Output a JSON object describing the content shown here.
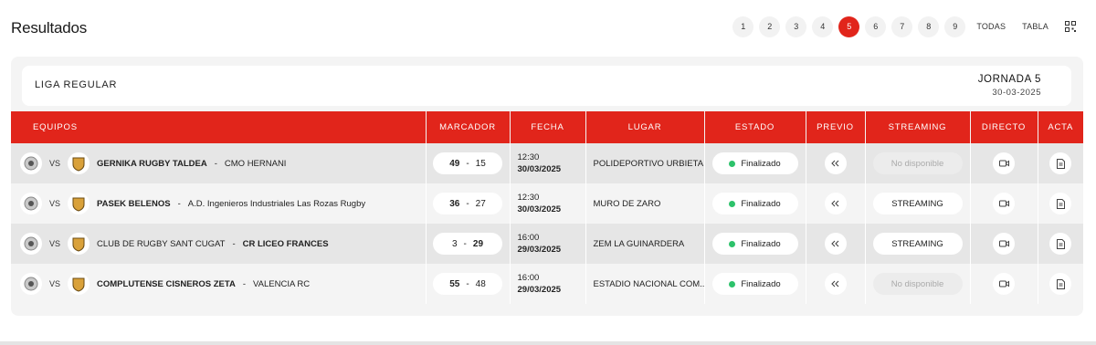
{
  "header": {
    "title": "Resultados",
    "pages": [
      "1",
      "2",
      "3",
      "4",
      "5",
      "6",
      "7",
      "8",
      "9"
    ],
    "active_page": "5",
    "all_label": "TODAS",
    "table_label": "TABLA"
  },
  "league": {
    "name": "LIGA REGULAR",
    "jornada": "JORNADA 5",
    "date": "30-03-2025"
  },
  "columns": {
    "equipos": "EQUIPOS",
    "marcador": "MARCADOR",
    "fecha": "FECHA",
    "lugar": "LUGAR",
    "estado": "ESTADO",
    "previo": "PREVIO",
    "streaming": "STREAMING",
    "directo": "DIRECTO",
    "acta": "ACTA"
  },
  "matches": [
    {
      "vs": "VS",
      "home": "GERNIKA RUGBY TALDEA",
      "away": "CMO HERNANI",
      "winner": "home",
      "home_score": "49",
      "away_score": "15",
      "dash": "-",
      "time": "12:30",
      "date": "30/03/2025",
      "venue": "POLIDEPORTIVO URBIETA",
      "status": "Finalizado",
      "streaming": "No disponible",
      "streaming_available": false
    },
    {
      "vs": "VS",
      "home": "PASEK BELENOS",
      "away": "A.D. Ingenieros Industriales Las Rozas Rugby",
      "winner": "home",
      "home_score": "36",
      "away_score": "27",
      "dash": "-",
      "time": "12:30",
      "date": "30/03/2025",
      "venue": "MURO DE ZARO",
      "status": "Finalizado",
      "streaming": "STREAMING",
      "streaming_available": true
    },
    {
      "vs": "VS",
      "home": "CLUB DE RUGBY SANT CUGAT",
      "away": "CR LICEO FRANCES",
      "winner": "away",
      "home_score": "3",
      "away_score": "29",
      "dash": "-",
      "time": "16:00",
      "date": "29/03/2025",
      "venue": "ZEM LA GUINARDERA",
      "status": "Finalizado",
      "streaming": "STREAMING",
      "streaming_available": true
    },
    {
      "vs": "VS",
      "home": "COMPLUTENSE CISNEROS ZETA",
      "away": "VALENCIA RC",
      "winner": "home",
      "home_score": "55",
      "away_score": "48",
      "dash": "-",
      "time": "16:00",
      "date": "29/03/2025",
      "venue": "ESTADIO NACIONAL COM...",
      "status": "Finalizado",
      "streaming": "No disponible",
      "streaming_available": false
    }
  ],
  "colors": {
    "accent": "#e1251b",
    "status_dot": "#2dc26b"
  }
}
